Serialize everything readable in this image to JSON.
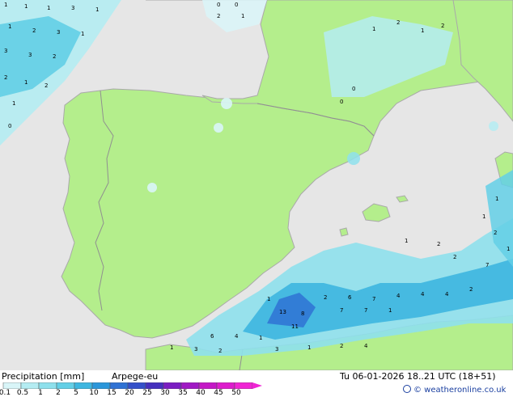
{
  "legend": {
    "title": "Precipitation [mm]",
    "model": "Arpege-eu",
    "time": "Tu 06-01-2026 18..21 UTC (18+51)",
    "credit": "© weatheronline.co.uk",
    "scale": [
      {
        "label": "0.1",
        "color": "#d9f5f8"
      },
      {
        "label": "0.5",
        "color": "#b4ecf2"
      },
      {
        "label": "1",
        "color": "#8ee0ec"
      },
      {
        "label": "2",
        "color": "#63cfe6"
      },
      {
        "label": "5",
        "color": "#3db6e0"
      },
      {
        "label": "10",
        "color": "#2a96da"
      },
      {
        "label": "15",
        "color": "#2f72d4"
      },
      {
        "label": "20",
        "color": "#3450c9"
      },
      {
        "label": "25",
        "color": "#4530be"
      },
      {
        "label": "30",
        "color": "#7a1dc2"
      },
      {
        "label": "35",
        "color": "#a018c4"
      },
      {
        "label": "40",
        "color": "#c418c6"
      },
      {
        "label": "45",
        "color": "#dd1ccc"
      },
      {
        "label": "50",
        "color": "#f024d4"
      }
    ]
  },
  "colors": {
    "land": "#b4ee8c",
    "sea": "#e6e6e6",
    "border": "#909090",
    "coast": "#a9a9a9"
  }
}
